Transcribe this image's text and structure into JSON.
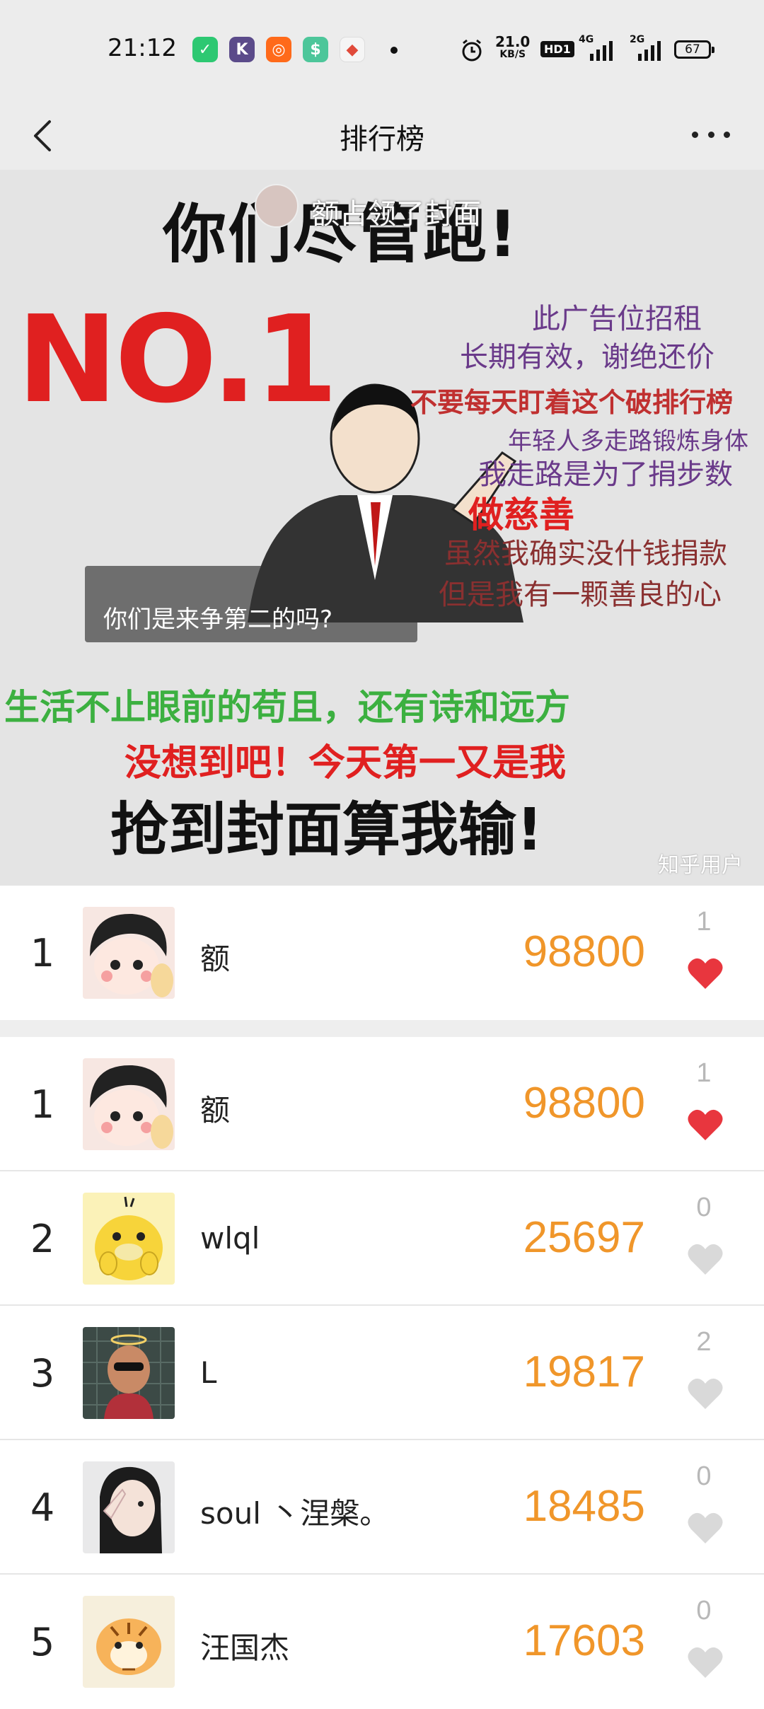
{
  "status_bar": {
    "time": "21:12",
    "net_speed_value": "21.0",
    "net_speed_unit": "KB/S",
    "hd_label": "HD1",
    "signal1_label": "4G",
    "signal2_label": "2G",
    "battery": "67"
  },
  "header": {
    "title": "排行榜"
  },
  "banner": {
    "top_text": "你们尽管跑!",
    "owner_text": "额占领了封面",
    "no1": "NO.1",
    "ad_lines": [
      "此广告位招租",
      "长期有效，谢绝还价",
      "不要每天盯着这个破排行榜",
      "年轻人多走路锻炼身体",
      "我走路是为了捐步数",
      "做慈善",
      "虽然我确实没什钱捐款",
      "但是我有一颗善良的心"
    ],
    "podium_text": "你们是来争第二的吗?",
    "green_text": "生活不止眼前的苟且，还有诗和远方",
    "red_text": "没想到吧！今天第一又是我",
    "bottom_text": "抢到封面算我输!",
    "watermark": "知乎用户"
  },
  "my_entry": {
    "rank": "1",
    "name": "额",
    "score": "98800",
    "likes": "1",
    "liked": true
  },
  "ranking": [
    {
      "rank": "1",
      "name": "额",
      "score": "98800",
      "likes": "1",
      "liked": true
    },
    {
      "rank": "2",
      "name": "wlql",
      "score": "25697",
      "likes": "0",
      "liked": false
    },
    {
      "rank": "3",
      "name": "L",
      "score": "19817",
      "likes": "2",
      "liked": false
    },
    {
      "rank": "4",
      "name": "soul 丶涅槃。",
      "score": "18485",
      "likes": "0",
      "liked": false
    },
    {
      "rank": "5",
      "name": "汪国杰",
      "score": "17603",
      "likes": "0",
      "liked": false
    }
  ],
  "colors": {
    "score": "#f0962a",
    "heart_liked": "#e8363e",
    "heart_unliked": "#d9d9d9"
  }
}
